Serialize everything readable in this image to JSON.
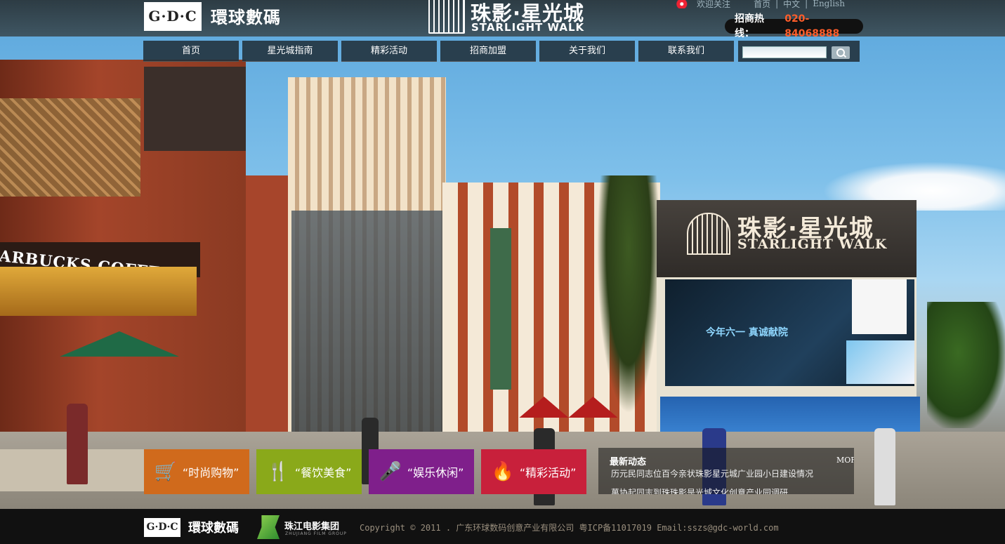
{
  "header": {
    "gdc_logo_text": "G·D·C",
    "gdc_name": "環球數碼",
    "brand_cn": "珠影·星光城",
    "brand_en": "STARLIGHT WALK",
    "top_links": [
      "欢迎关注",
      "首页",
      "中文",
      "English"
    ],
    "hotline_label": "招商热线：",
    "hotline_number": "020-84068888"
  },
  "nav": {
    "items": [
      "首页",
      "星光城指南",
      "精彩活动",
      "招商加盟",
      "关于我们",
      "联系我们"
    ]
  },
  "search": {
    "placeholder": "",
    "value": ""
  },
  "scene": {
    "store_sign": "ARBUCKS COFFEE",
    "building_sign_cn": "珠影·星光城",
    "building_sign_en": "STARLIGHT WALK",
    "screen_text": "今年六一 真诚献院"
  },
  "tiles": [
    {
      "label": "“时尚购物”",
      "icon": "shopping-cart-icon",
      "color": "#d06a1c"
    },
    {
      "label": "“餐饮美食”",
      "icon": "fork-spoon-icon",
      "color": "#8aa91a"
    },
    {
      "label": "“娱乐休闲”",
      "icon": "microphone-icon",
      "color": "#7f1f8b"
    },
    {
      "label": "“精彩活动”",
      "icon": "flame-icon",
      "color": "#c8203b"
    }
  ],
  "news": {
    "title": "最新动态",
    "more": "MORE",
    "items": [
      "历元民同志位百今亲状珠影星元城广业园小日建设情况",
      "萬协起同志到珠珠影是光城文化创意产业园调研"
    ]
  },
  "footer": {
    "gdc_logo_text": "G·D·C",
    "gdc_name": "環球數碼",
    "zj_name": "珠江电影集团",
    "zj_en": "ZHUJIANG FILM GROUP",
    "copyright": "Copyright © 2011 . 广东环球数码创意产业有限公司 粤ICP备11017019 Email:sszs@gdc-world.com"
  },
  "colors": {
    "accent_orange": "#ff5d2a",
    "nav_bg": "#213039"
  }
}
